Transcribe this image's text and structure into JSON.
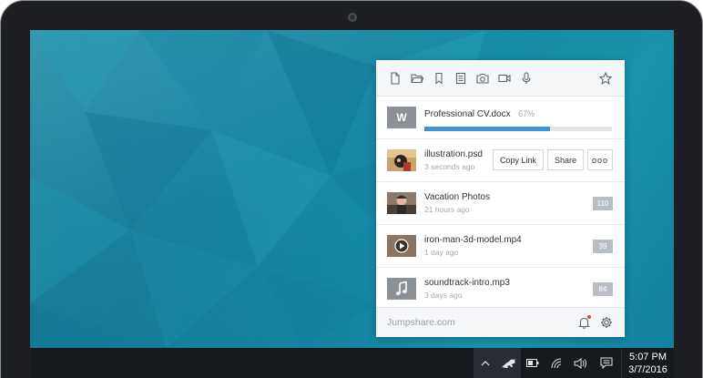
{
  "colors": {
    "accent": "#3a92d8",
    "desktop": "#1987a3",
    "taskbar": "#16191d",
    "notification": "#e8464b"
  },
  "toolbar": {
    "icons": [
      "file-icon",
      "folder-icon",
      "bookmark-icon",
      "note-icon",
      "camera-icon",
      "video-icon",
      "microphone-icon",
      "star-icon"
    ]
  },
  "upload": {
    "badge": "W",
    "name": "Professional CV.docx",
    "percent_label": "67%",
    "progress": 0.67
  },
  "items": [
    {
      "name": "illustration.psd",
      "time": "3 seconds ago",
      "thumb": "illustration-thumbnail"
    },
    {
      "name": "Vacation Photos",
      "time": "21 hours ago",
      "count": "110",
      "thumb": "photo-thumbnail"
    },
    {
      "name": "iron-man-3d-model.mp4",
      "time": "1 day ago",
      "count": "39",
      "thumb": "video-thumbnail"
    },
    {
      "name": "soundtrack-intro.mp3",
      "time": "3 days ago",
      "count": "84",
      "thumb": "music-icon"
    }
  ],
  "actions": {
    "copy_link": "Copy Link",
    "share": "Share",
    "more": "ooo"
  },
  "footer": {
    "brand": "Jumpshare.com",
    "icons": [
      "bell-icon",
      "gear-icon"
    ]
  },
  "taskbar": {
    "time": "5:07 PM",
    "date": "3/7/2016",
    "tray_icons": [
      "chevron-up-icon",
      "jumpshare-kangaroo-icon",
      "battery-icon",
      "wifi-icon",
      "volume-icon",
      "action-center-icon"
    ]
  }
}
